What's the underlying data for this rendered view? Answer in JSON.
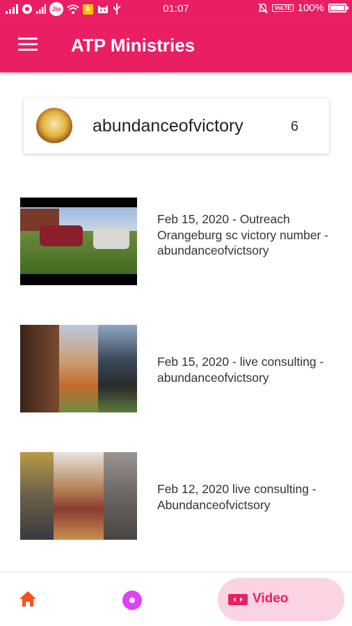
{
  "status_bar": {
    "time": "01:07",
    "battery": "100%",
    "carrier_badge": "Jio",
    "volte": "VoLTE",
    "colors": {
      "background": "#e91e63"
    }
  },
  "app_bar": {
    "title": "ATP Ministries",
    "menu_icon": "hamburger-menu-icon"
  },
  "channel": {
    "name": "abundanceofvictory",
    "count": "6"
  },
  "videos": [
    {
      "title": "Feb 15, 2020 - Outreach Orangeburg sc victory number - abundanceofvictsory"
    },
    {
      "title": "Feb 15, 2020 - live consulting - abundanceofvictsory"
    },
    {
      "title": "Feb 12, 2020 live consulting - Abundanceofvictsory"
    }
  ],
  "bottom_nav": {
    "items": [
      {
        "icon": "home-icon"
      },
      {
        "icon": "disc-icon"
      },
      {
        "icon": "video-camera-icon",
        "label": "Video",
        "selected": true
      }
    ]
  },
  "colors": {
    "primary": "#e91e63",
    "selected_tab_bg": "#fbd4e3",
    "disc": "#e040fb",
    "home": "#f4511e"
  }
}
